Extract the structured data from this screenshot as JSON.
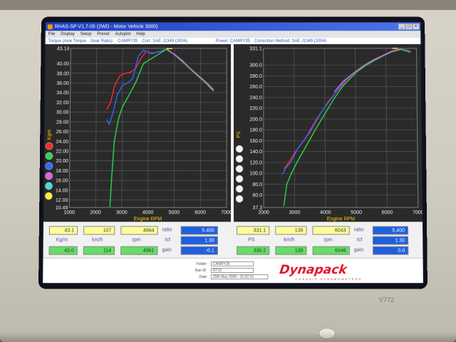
{
  "window": {
    "title": "RHAS-SP V1.7-05   (2WD - Motor Vehicle 3000)",
    "menu": [
      "File",
      "Display",
      "Setup",
      "Preset",
      "Autoplot",
      "Help"
    ]
  },
  "info": {
    "torque_label": "Torque (Axle Torque",
    "gear_ratio_label": "Gear Ratio):",
    "torque_run": "CAMRY35",
    "corr_label": "Corr: SAE J1349 (2004)",
    "power_label": "Power: CAMRY35",
    "correction_method": "Correction Method: SAE J1349 (2004)"
  },
  "colors": {
    "red": "#ff2a2a",
    "green": "#29d94a",
    "blue": "#2a6aff",
    "magenta": "#e060e0",
    "cyan": "#40e0e0",
    "yellow": "#ffee33",
    "plot_bg": "#2a2a2a",
    "grid": "#5a5a5a",
    "axis_text": "#f2f2f2",
    "label": "#ffcc00"
  },
  "chart_data": [
    {
      "type": "line",
      "xlabel": "Engine RPM",
      "ylabel": "Kgm",
      "xlim": [
        1000,
        7000
      ],
      "ylim": [
        10.49,
        43.14
      ],
      "xticks": [
        1000,
        2000,
        3000,
        4000,
        5000,
        6000,
        7000
      ],
      "yticks": [
        10.49,
        12.0,
        14.0,
        16.0,
        18.0,
        20.0,
        22.0,
        24.0,
        26.0,
        28.0,
        30.0,
        32.0,
        34.0,
        36.0,
        38.0,
        40.0,
        43.14
      ],
      "ytick_labels": [
        "10.49",
        "12.00",
        "14.00",
        "16.00",
        "18.00",
        "20.00",
        "22.00",
        "24.00",
        "26.00",
        "28.00",
        "30.00",
        "32.00",
        "34.00",
        "36.00",
        "38.00",
        "40.00",
        "43.14"
      ],
      "grid": true,
      "legend_dots": [
        "red",
        "green",
        "blue",
        "magenta",
        "cyan",
        "yellow"
      ],
      "series": [
        {
          "color": "red",
          "x": [
            2400,
            2550,
            2700,
            2900,
            3100,
            3300,
            3500,
            3700,
            3900,
            4100,
            4400,
            4700,
            5000,
            5300,
            5600,
            5900,
            6200,
            6500
          ],
          "y": [
            30.5,
            32.0,
            35.5,
            37.5,
            38.0,
            38.2,
            39.0,
            41.0,
            42.5,
            42.2,
            42.4,
            43.0,
            41.8,
            40.5,
            38.9,
            37.5,
            36.2,
            34.6
          ]
        },
        {
          "color": "blue",
          "x": [
            2400,
            2500,
            2650,
            2800,
            3000,
            3200,
            3400,
            3600,
            3800,
            4100,
            4400,
            4700,
            5000,
            5300,
            5600,
            5900,
            6200,
            6500
          ],
          "y": [
            28.5,
            27.5,
            30.0,
            33.5,
            35.5,
            36.0,
            37.0,
            41.5,
            42.8,
            42.0,
            42.5,
            43.0,
            41.8,
            40.4,
            38.9,
            37.5,
            36.1,
            34.5
          ]
        },
        {
          "color": "green",
          "x": [
            2550,
            2600,
            2700,
            2850,
            3000,
            3200,
            3500,
            3800,
            4100,
            4400,
            4700,
            5000,
            5300,
            5600,
            5900,
            6200,
            6500
          ],
          "y": [
            10.6,
            16.0,
            24.0,
            28.5,
            31.0,
            33.0,
            36.0,
            40.0,
            41.0,
            42.0,
            43.0,
            41.8,
            40.4,
            38.9,
            37.4,
            36.0,
            34.3
          ]
        },
        {
          "color": "magenta",
          "x": [
            4700,
            5000,
            5300,
            5600,
            5900,
            6200,
            6500
          ],
          "y": [
            42.8,
            41.9,
            40.6,
            39.0,
            37.6,
            36.2,
            34.6
          ]
        }
      ],
      "peak_marker": {
        "x": 4800,
        "y": 43.1
      }
    },
    {
      "type": "line",
      "xlabel": "Engine RPM",
      "ylabel": "PS",
      "xlim": [
        2000,
        7000
      ],
      "ylim": [
        37.3,
        331.1
      ],
      "xticks": [
        2000,
        3000,
        4000,
        5000,
        6000,
        7000
      ],
      "xtick_labels": [
        "2000",
        "3000",
        "4000",
        "5000",
        "6000",
        "7000"
      ],
      "yticks": [
        37.3,
        60.0,
        80.0,
        100.0,
        120.0,
        140.0,
        160.0,
        180.0,
        200.0,
        220.0,
        240.0,
        260.0,
        280.0,
        300.0,
        331.1
      ],
      "ytick_labels": [
        "37.3",
        "60.0",
        "80.0",
        "100.0",
        "120.0",
        "140.0",
        "160.0",
        "180.0",
        "200.0",
        "220.0",
        "240.0",
        "260.0",
        "280.0",
        "300.0",
        "331.1"
      ],
      "grid": true,
      "series": [
        {
          "color": "red",
          "x": [
            2650,
            2800,
            3000,
            3200,
            3500,
            3800,
            4100,
            4400,
            4700,
            5000,
            5300,
            5600,
            5900,
            6200,
            6500,
            6800
          ],
          "y": [
            108,
            118,
            137,
            152,
            175,
            205,
            232,
            252,
            272,
            288,
            300,
            310,
            318,
            326,
            330,
            326
          ]
        },
        {
          "color": "blue",
          "x": [
            2600,
            2750,
            2900,
            3100,
            3400,
            3700,
            4000,
            4300,
            4600,
            5000,
            5300,
            5600,
            5900,
            6200,
            6500,
            6800
          ],
          "y": [
            98,
            112,
            122,
            145,
            168,
            198,
            222,
            245,
            268,
            288,
            300,
            310,
            318,
            326,
            330,
            325
          ]
        },
        {
          "color": "green",
          "x": [
            2650,
            2750,
            2900,
            3100,
            3400,
            3700,
            4000,
            4300,
            4600,
            5000,
            5300,
            5600,
            5900,
            6200,
            6500,
            6800
          ],
          "y": [
            40,
            80,
            100,
            122,
            152,
            182,
            210,
            238,
            262,
            285,
            298,
            308,
            317,
            325,
            329,
            324
          ]
        },
        {
          "color": "magenta",
          "x": [
            4300,
            4600,
            5000,
            5300,
            5600,
            5900,
            6200,
            6500
          ],
          "y": [
            250,
            270,
            288,
            300,
            310,
            318,
            326,
            330
          ]
        }
      ],
      "peak_marker": {
        "x": 6300,
        "y": 331.1
      }
    }
  ],
  "readouts": {
    "row1": {
      "torque": "43.1",
      "speed": "107",
      "rpm_t": "4664",
      "ratio_label": "ratio",
      "ratio": "5.400",
      "power": "331.1",
      "speed2": "139",
      "rpm_p": "6043",
      "ratio_label2": "ratio",
      "ratio2": "5.400"
    },
    "units": {
      "kgm": "Kg/m",
      "kmh": "km/h",
      "rpm": "rpm",
      "tcf": "tcf",
      "ps": "PS",
      "kmh2": "km/h",
      "rpm2": "rpm",
      "tcf2": "tcf"
    },
    "row2": {
      "torque": "43.0",
      "speed": "114",
      "rpm_t": "4961",
      "tcf": "1.30",
      "power": "330.2",
      "speed2": "139",
      "rpm_p": "6046",
      "tcf2": "1.30"
    },
    "row3": {
      "gain_label": "gain",
      "gain": "-0.1",
      "gain_label2": "gain",
      "gain2": "0.0"
    }
  },
  "footer": {
    "folder_label": "Folder",
    "folder_value": "CAMRY35",
    "run_label": "Run ID",
    "run_value": "RT10",
    "date_label": "Date",
    "date_value": "20th May 2008 - 15:22:31",
    "logo": "Dynapack",
    "logo_sub": "CHASSIS DYNAMOMETERS"
  },
  "monitor": {
    "model": "V772"
  }
}
